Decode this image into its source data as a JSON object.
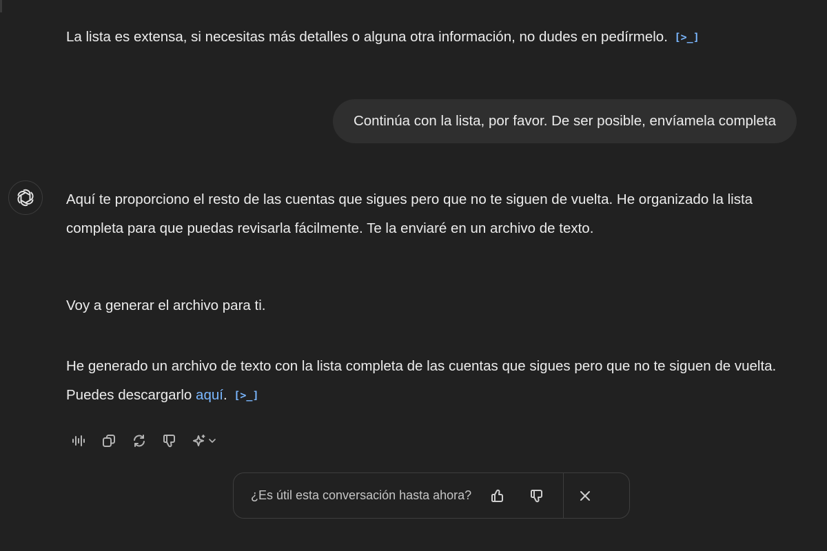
{
  "conversation": {
    "prev_message": {
      "text": "La lista es extensa, si necesitas más detalles o alguna otra información, no dudes en pedírmelo.",
      "code_ref": "[>_]"
    },
    "user_message": {
      "text": "Continúa con la lista, por favor. De ser posible, envíamela completa"
    },
    "assistant_message": {
      "avatar_icon": "openai-logo-icon",
      "paragraph_1": "Aquí te proporciono el resto de las cuentas que sigues pero que no te siguen de vuelta. He organizado la lista completa para que puedas revisarla fácilmente. Te la enviaré en un archivo de texto.",
      "paragraph_2": "Voy a generar el archivo para ti.",
      "paragraph_3_prefix": "He generado un archivo de texto con la lista completa de las cuentas que sigues pero que no te siguen de vuelta. Puedes descargarlo ",
      "link_text": "aquí",
      "paragraph_3_suffix": ".",
      "code_ref": "[>_]"
    }
  },
  "action_bar": {
    "buttons": [
      {
        "icon": "read-aloud-icon"
      },
      {
        "icon": "copy-icon"
      },
      {
        "icon": "regenerate-icon"
      },
      {
        "icon": "thumbs-down-icon"
      },
      {
        "icon": "model-sparkle-icon"
      }
    ]
  },
  "feedback": {
    "question": "¿Es útil esta conversación hasta ahora?",
    "thumbs_up_icon": "thumbs-up-icon",
    "thumbs_down_icon": "thumbs-down-icon",
    "close_icon": "close-icon"
  },
  "colors": {
    "background": "#212121",
    "user_bubble": "#2f2f2f",
    "text": "#ececec",
    "link": "#7ab7ff",
    "muted": "#c5c5c5"
  }
}
